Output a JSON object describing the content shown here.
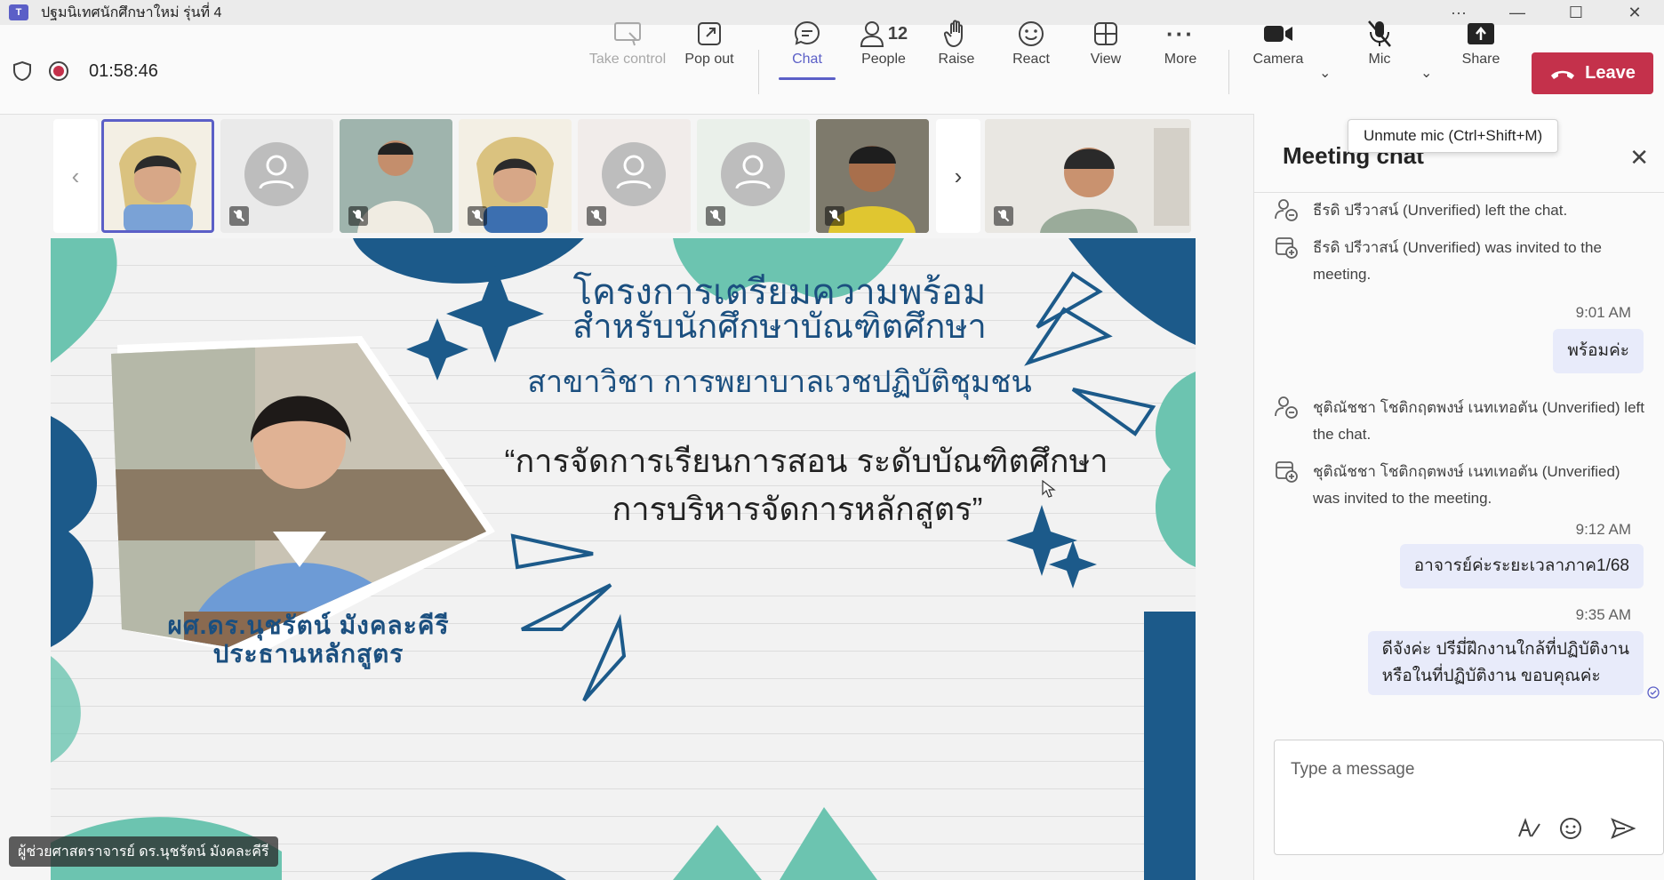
{
  "window": {
    "title": "ปฐมนิเทศนักศึกษาใหม่ รุ่นที่ 4",
    "logo_letter": "T"
  },
  "toolbar": {
    "timer": "01:58:46",
    "take_control": "Take control",
    "pop_out": "Pop out",
    "chat": "Chat",
    "people": "People",
    "people_count": "12",
    "raise": "Raise",
    "react": "React",
    "view": "View",
    "more": "More",
    "camera": "Camera",
    "mic": "Mic",
    "share": "Share",
    "leave": "Leave"
  },
  "tooltip": "Unmute mic (Ctrl+Shift+M)",
  "slide": {
    "line1": "โครงการเตรียมความพร้อม",
    "line2": "สำหรับนักศึกษาบัณฑิตศึกษา",
    "line3": "สาขาวิชา การพยาบาลเวชปฏิบัติชุมชน",
    "line4": "“การจัดการเรียนการสอน ระดับบัณฑิตศึกษา",
    "line5": "การบริหารจัดการหลักสูตร”",
    "name1": "ผศ.ดร.นุชรัตน์ มังคละคีรี",
    "name2": "ประธานหลักสูตร"
  },
  "speaker_name": "ผู้ช่วยศาสตราจารย์ ดร.นุชรัตน์ มังคละคีรี",
  "chat": {
    "title": "Meeting chat",
    "compose_placeholder": "Type a message",
    "sys1": "ธีรดิ ปรีวาสน์ (Unverified) left the chat.",
    "sys2": "ธีรดิ ปรีวาสน์ (Unverified) was invited to the meeting.",
    "t1": "9:01 AM",
    "m1": "พร้อมค่ะ",
    "sys3": "ชุติณัชชา โชติกฤตพงษ์ เนทเทอตัน (Unverified) left the chat.",
    "sys4": "ชุติณัชชา โชติกฤตพงษ์ เนทเทอตัน (Unverified) was invited to the meeting.",
    "t2": "9:12 AM",
    "m2": "อาจารย์ค่ะระยะเวลาภาค1/68",
    "t3": "9:35 AM",
    "m3a": "ดีจังค่ะ ปรีมี่ฝึกงานใกล้ที่ปฏิบัติงาน",
    "m3b": "หรือในที่ปฏิบัติงาน ขอบคุณค่ะ"
  },
  "colors": {
    "accent": "#5b5fc7",
    "leave": "#c4314b",
    "slide_text": "#1b4f7f",
    "slide_teal": "#6cc4b0",
    "slide_navy": "#1c5a8a"
  }
}
